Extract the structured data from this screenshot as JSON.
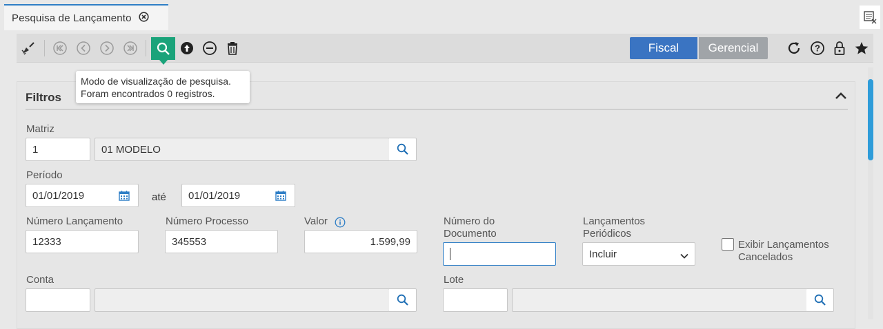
{
  "tab": {
    "title": "Pesquisa de Lançamento"
  },
  "toolbar": {
    "icons": [
      "broom-icon",
      "first-record-icon",
      "previous-record-icon",
      "next-record-icon",
      "last-record-icon",
      "search-icon",
      "upload-icon",
      "minus-circle-icon",
      "trash-icon",
      "refresh-icon",
      "help-icon",
      "lock-icon",
      "star-icon"
    ],
    "fiscal_label": "Fiscal",
    "gerencial_label": "Gerencial",
    "active_segment": "Fiscal"
  },
  "tooltip": {
    "line1": "Modo de visualização de pesquisa.",
    "line2": "Foram encontrados 0 registros."
  },
  "filters": {
    "title": "Filtros",
    "matriz": {
      "label": "Matriz",
      "code": "1",
      "name": "01 MODELO"
    },
    "periodo": {
      "label": "Período",
      "start": "01/01/2019",
      "connector": "até",
      "end": "01/01/2019"
    },
    "numero_lancamento": {
      "label": "Número Lançamento",
      "value": "12333"
    },
    "numero_processo": {
      "label": "Número Processo",
      "value": "345553"
    },
    "valor": {
      "label": "Valor",
      "value": "1.599,99"
    },
    "numero_documento": {
      "label_line1": "Número do",
      "label_line2": "Documento",
      "value": ""
    },
    "lancamentos_periodicos": {
      "label_line1": "Lançamentos",
      "label_line2": "Periódicos",
      "selected": "Incluir"
    },
    "exibir_cancelados": {
      "label_line1": "Exibir Lançamentos",
      "label_line2": "Cancelados",
      "checked": false
    },
    "conta": {
      "label": "Conta",
      "code": "",
      "name": ""
    },
    "lote": {
      "label": "Lote",
      "code": "",
      "name": ""
    }
  },
  "colors": {
    "accent": "#2e7ec6",
    "active_search": "#1aa37a",
    "fiscal": "#3a74c2",
    "gerencial": "#a0a4a8"
  }
}
